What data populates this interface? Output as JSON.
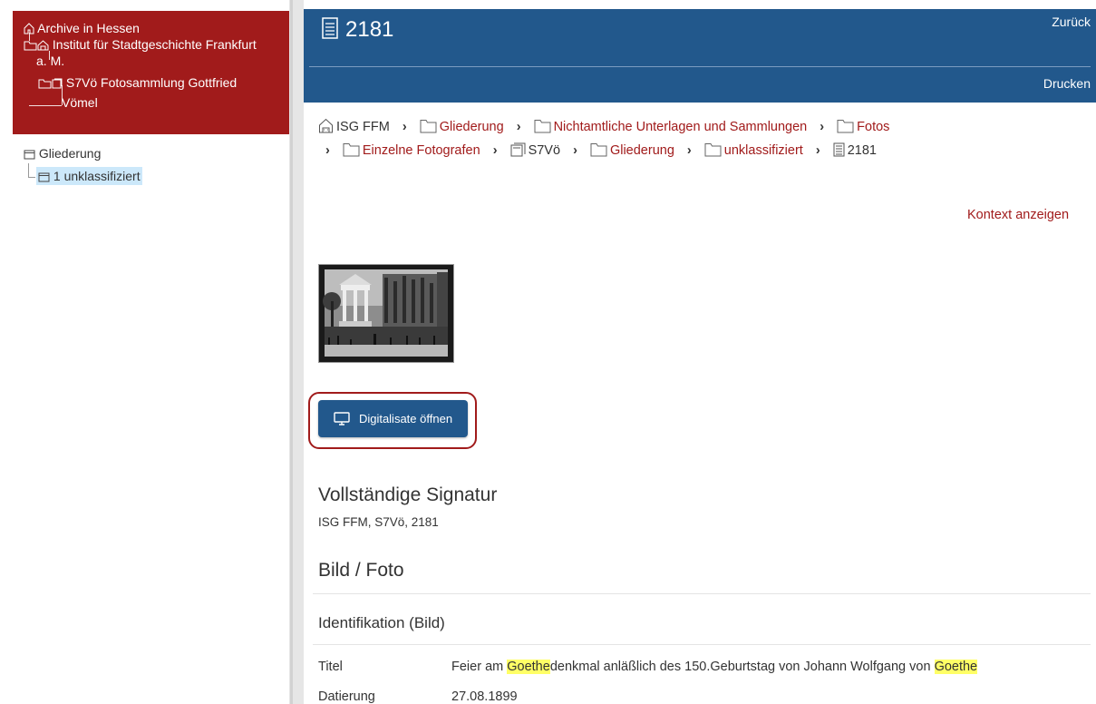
{
  "sidebar": {
    "tree": [
      {
        "label": "Archive in Hessen"
      },
      {
        "label": "Institut für Stadtgeschichte Frankfurt",
        "label_cont": "a. M."
      },
      {
        "label": "S7Vö Fotosammlung Gottfried",
        "label_cont": "Vömel"
      }
    ],
    "local_tree": [
      {
        "label": "Gliederung"
      },
      {
        "label": "1 unklassifiziert",
        "selected": true
      }
    ]
  },
  "header": {
    "title": "2181",
    "back_label": "Zurück",
    "print_label": "Drucken",
    "bg_color": "#22588c"
  },
  "breadcrumb": [
    {
      "label": "ISG FFM",
      "icon": "institution-icon",
      "link": false
    },
    {
      "label": "Gliederung",
      "icon": "folder-icon",
      "link": true
    },
    {
      "label": "Nichtamtliche Unterlagen und Sammlungen",
      "icon": "folder-icon",
      "link": true
    },
    {
      "label": "Fotos",
      "icon": "folder-icon",
      "link": true
    },
    {
      "label": "Einzelne Fotografen",
      "icon": "folder-icon",
      "link": true
    },
    {
      "label": "S7Vö",
      "icon": "collection-icon",
      "link": false
    },
    {
      "label": "Gliederung",
      "icon": "folder-icon",
      "link": true
    },
    {
      "label": "unklassifiziert",
      "icon": "folder-icon",
      "link": true
    },
    {
      "label": "2181",
      "icon": "document-icon",
      "link": false
    }
  ],
  "context_link": "Kontext anzeigen",
  "thumbnail": {
    "icon": "photo-thumbnail"
  },
  "digitalisate_button": {
    "label": "Digitalisate öffnen",
    "icon": "monitor-icon"
  },
  "signatur": {
    "heading": "Vollständige Signatur",
    "value": "ISG FFM, S7Vö, 2181"
  },
  "bild_heading": "Bild / Foto",
  "identifikation": {
    "heading": "Identifikation (Bild)",
    "fields": [
      {
        "label": "Titel",
        "parts": [
          "Feier am ",
          "Goethe",
          "denkmal anläßlich des 150.Geburtstag von Johann Wolfgang von ",
          "Goethe"
        ]
      },
      {
        "label": "Datierung",
        "value": "27.08.1899"
      }
    ]
  },
  "colors": {
    "accent_red": "#a11b1b",
    "primary_blue": "#22588c",
    "highlight": "#ffff66",
    "selection": "#cce8fa"
  }
}
